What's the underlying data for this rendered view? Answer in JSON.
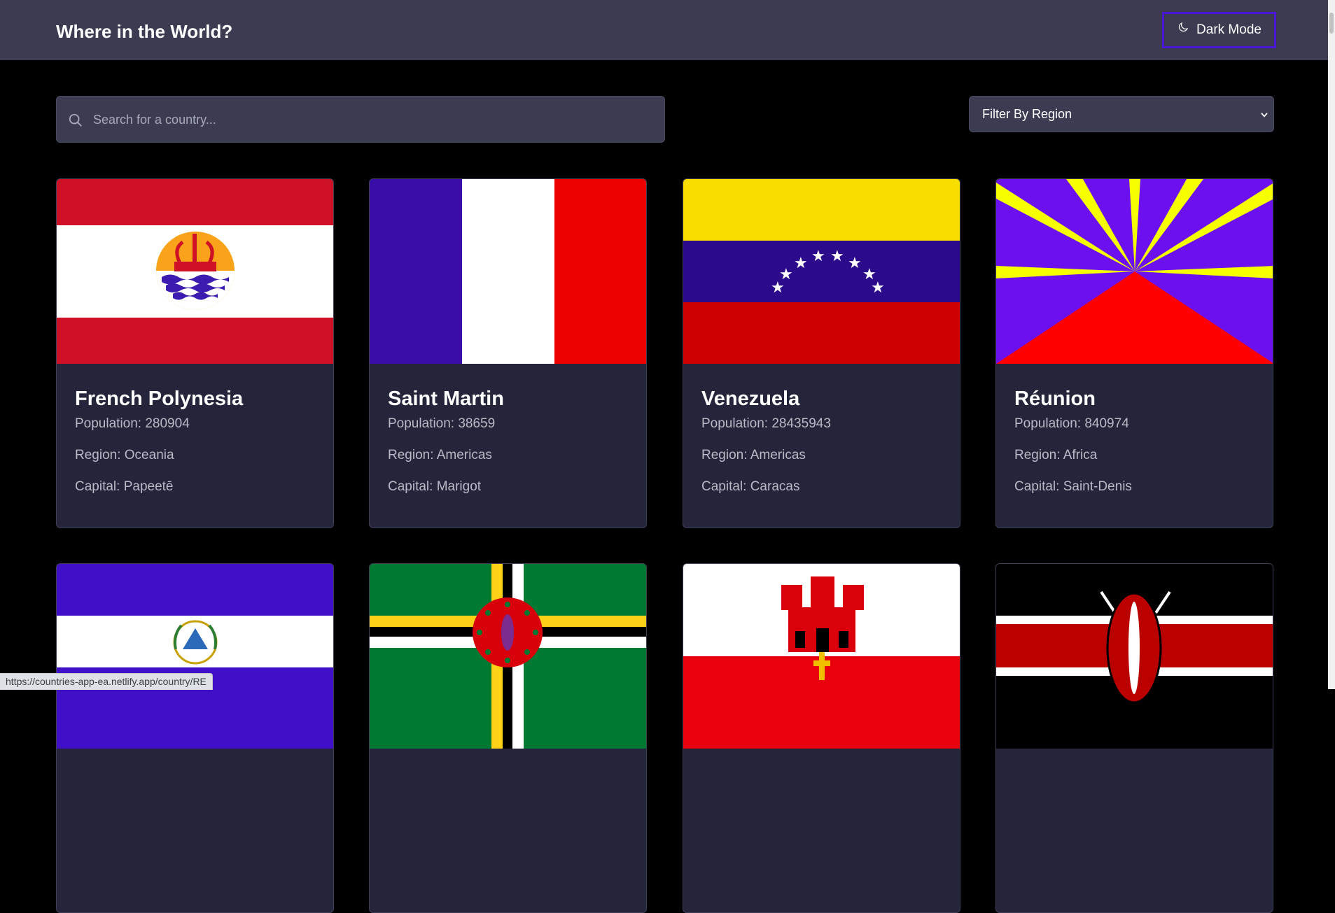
{
  "header": {
    "title": "Where in the World?",
    "dark_mode_label": "Dark Mode"
  },
  "search": {
    "placeholder": "Search for a country...",
    "value": ""
  },
  "filter": {
    "label": "Filter By Region"
  },
  "labels": {
    "population": "Population:",
    "region": "Region:",
    "capital": "Capital:"
  },
  "countries": [
    {
      "name": "French Polynesia",
      "population": "280904",
      "region": "Oceania",
      "capital": "Papeetē"
    },
    {
      "name": "Saint Martin",
      "population": "38659",
      "region": "Americas",
      "capital": "Marigot"
    },
    {
      "name": "Venezuela",
      "population": "28435943",
      "region": "Americas",
      "capital": "Caracas"
    },
    {
      "name": "Réunion",
      "population": "840974",
      "region": "Africa",
      "capital": "Saint-Denis"
    }
  ],
  "status_url": "https://countries-app-ea.netlify.app/country/RE",
  "colors": {
    "background": "#000000",
    "header": "#3b3c52",
    "card": "#24253a",
    "accent_outline": "#4b17d6"
  },
  "icons": {
    "search": "search-icon",
    "moon": "moon-icon",
    "chevron": "chevron-down-icon"
  }
}
